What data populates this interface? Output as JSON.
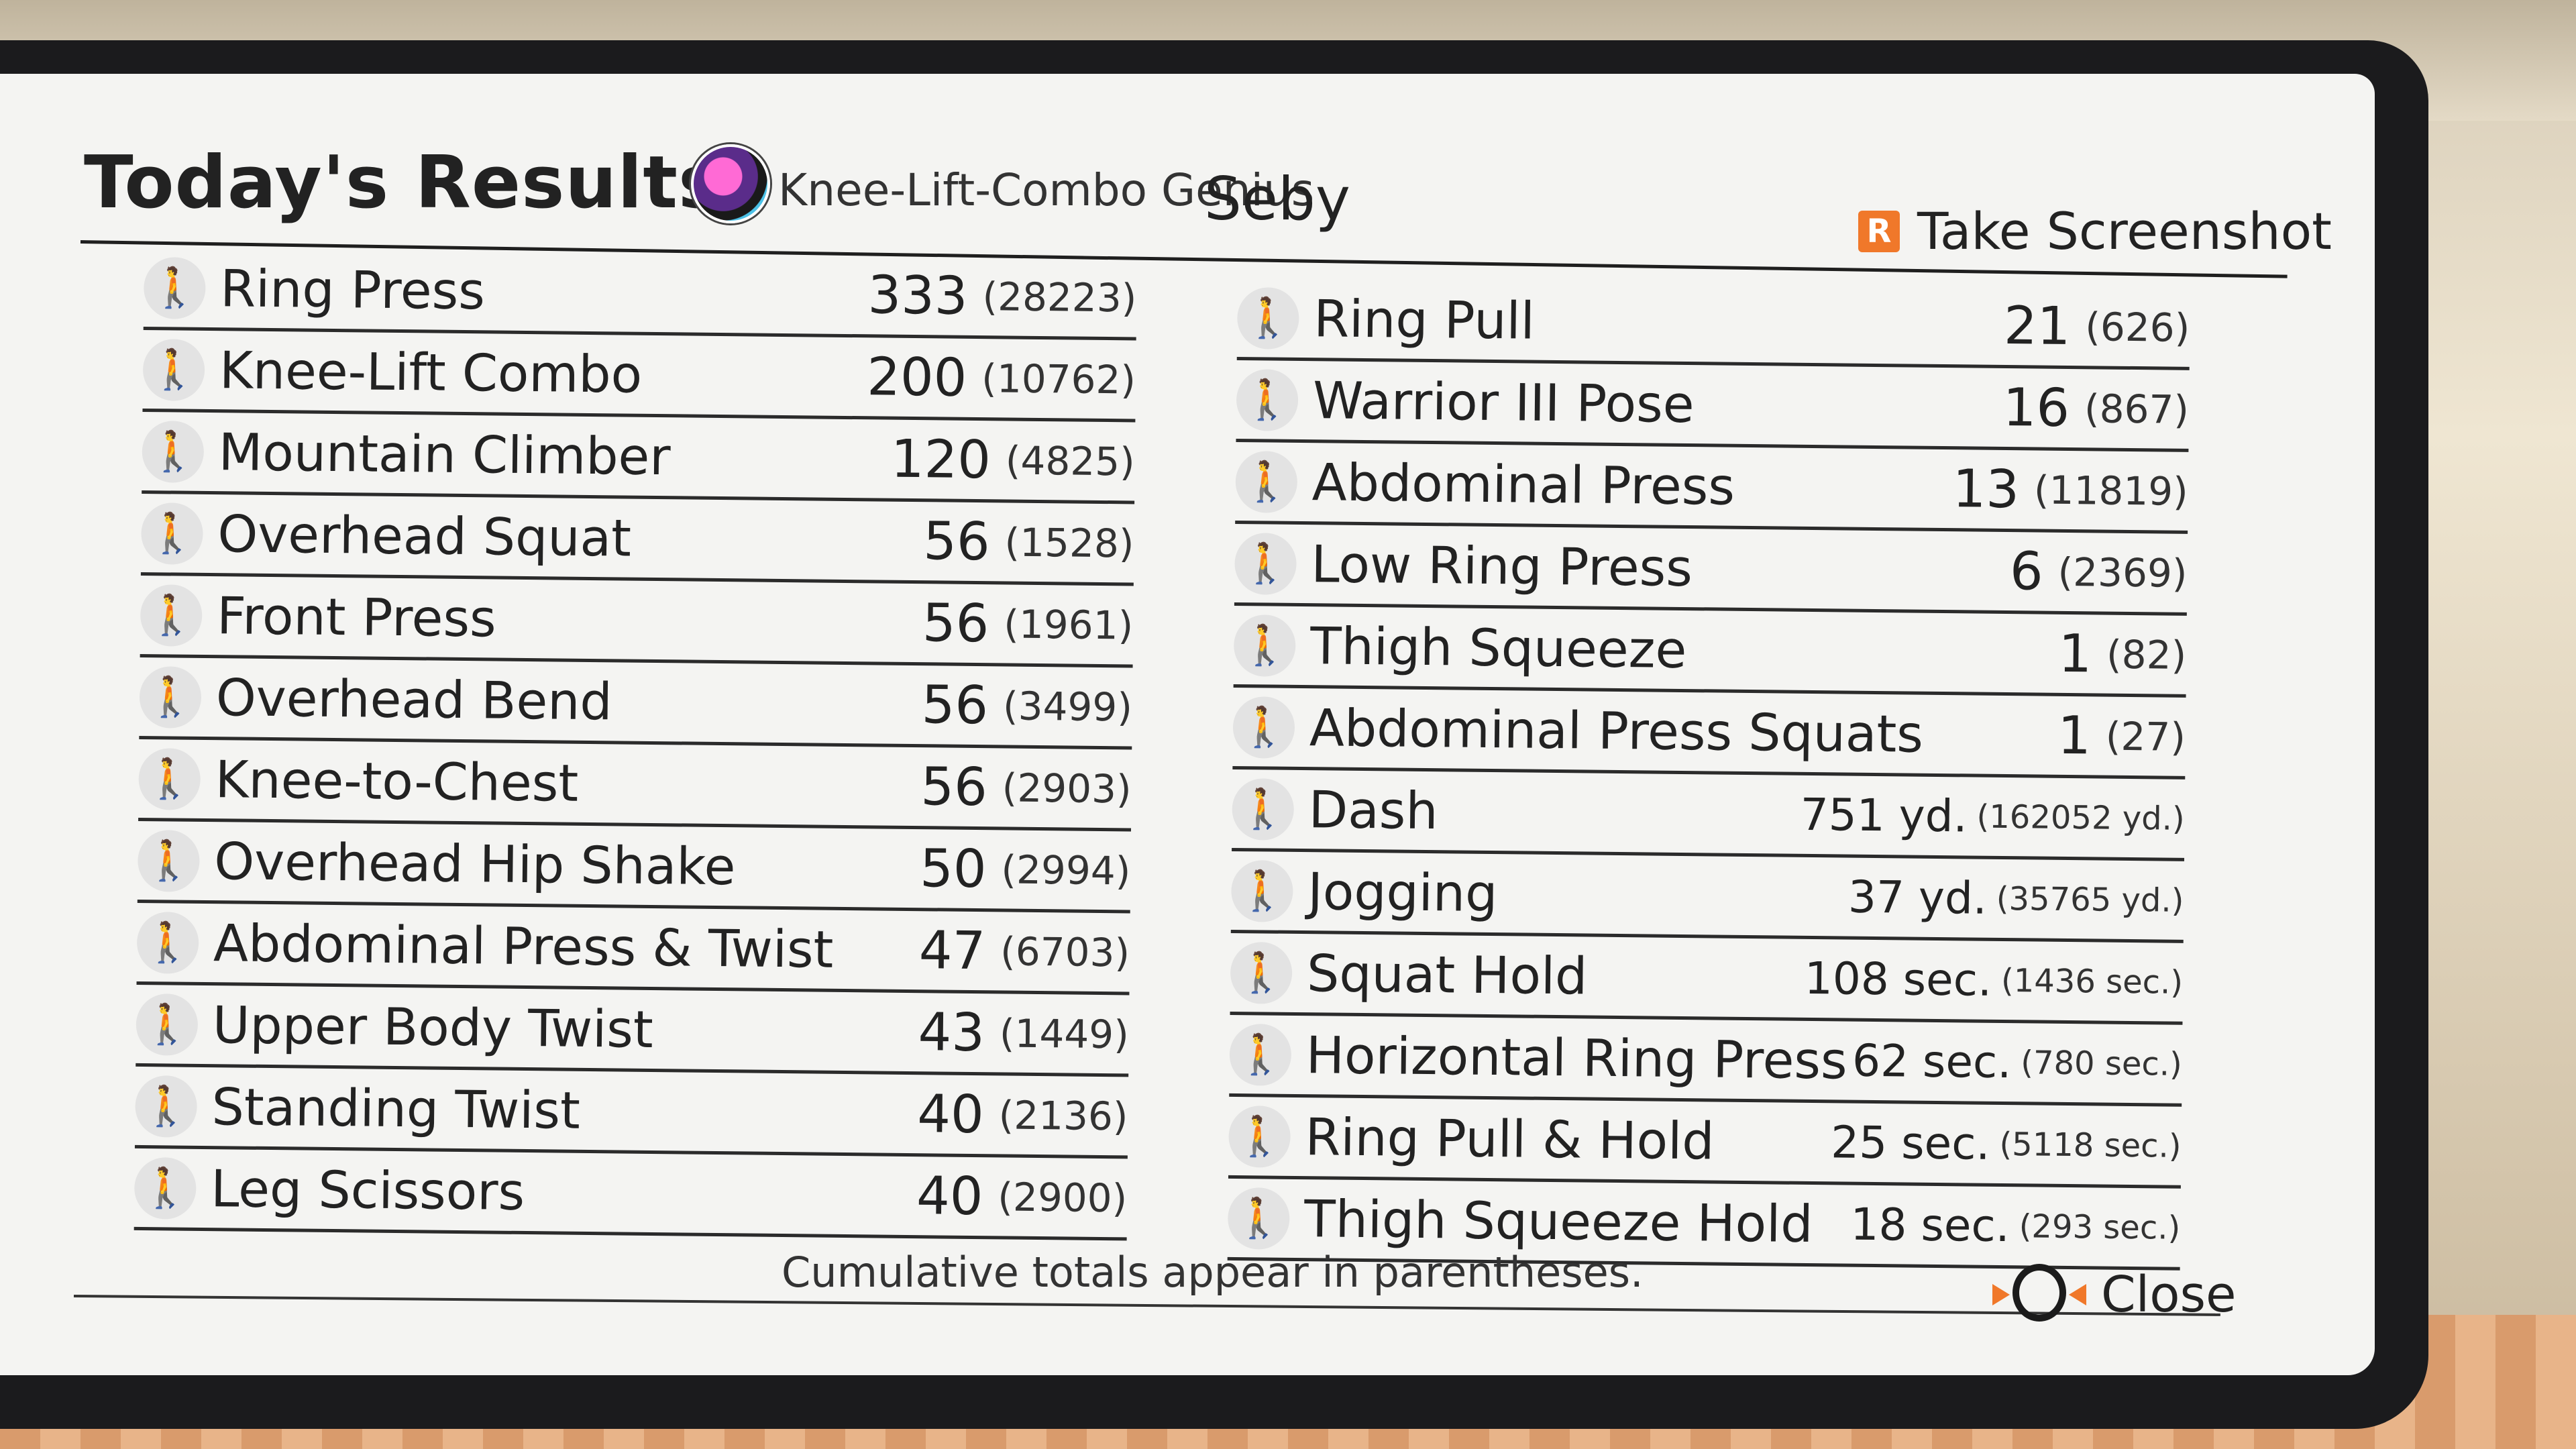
{
  "header": {
    "title": "Today's Results",
    "user_title": "Knee-Lift-Combo Genius",
    "user_name": "Seby",
    "screenshot_button": "R",
    "screenshot_label": "Take Screenshot"
  },
  "left_column": [
    {
      "name": "Ring Press",
      "value": "333",
      "cumulative": "(28223)"
    },
    {
      "name": "Knee-Lift Combo",
      "value": "200",
      "cumulative": "(10762)"
    },
    {
      "name": "Mountain Climber",
      "value": "120",
      "cumulative": "(4825)"
    },
    {
      "name": "Overhead Squat",
      "value": "56",
      "cumulative": "(1528)"
    },
    {
      "name": "Front Press",
      "value": "56",
      "cumulative": "(1961)"
    },
    {
      "name": "Overhead Bend",
      "value": "56",
      "cumulative": "(3499)"
    },
    {
      "name": "Knee-to-Chest",
      "value": "56",
      "cumulative": "(2903)"
    },
    {
      "name": "Overhead Hip Shake",
      "value": "50",
      "cumulative": "(2994)"
    },
    {
      "name": "Abdominal Press & Twist",
      "value": "47",
      "cumulative": "(6703)"
    },
    {
      "name": "Upper Body Twist",
      "value": "43",
      "cumulative": "(1449)"
    },
    {
      "name": "Standing Twist",
      "value": "40",
      "cumulative": "(2136)"
    },
    {
      "name": "Leg Scissors",
      "value": "40",
      "cumulative": "(2900)"
    }
  ],
  "right_column": [
    {
      "name": "Ring Pull",
      "value": "21",
      "cumulative": "(626)"
    },
    {
      "name": "Warrior III Pose",
      "value": "16",
      "cumulative": "(867)"
    },
    {
      "name": "Abdominal Press",
      "value": "13",
      "cumulative": "(11819)"
    },
    {
      "name": "Low Ring Press",
      "value": "6",
      "cumulative": "(2369)"
    },
    {
      "name": "Thigh Squeeze",
      "value": "1",
      "cumulative": "(82)"
    },
    {
      "name": "Abdominal Press Squats",
      "value": "1",
      "cumulative": "(27)"
    },
    {
      "name": "Dash",
      "value": "751 yd.",
      "cumulative": "(162052 yd.)"
    },
    {
      "name": "Jogging",
      "value": "37 yd.",
      "cumulative": "(35765 yd.)"
    },
    {
      "name": "Squat Hold",
      "value": "108 sec.",
      "cumulative": "(1436 sec.)"
    },
    {
      "name": "Horizontal Ring Press",
      "value": "62 sec.",
      "cumulative": "(780 sec.)"
    },
    {
      "name": "Ring Pull & Hold",
      "value": "25 sec.",
      "cumulative": "(5118 sec.)"
    },
    {
      "name": "Thigh Squeeze Hold",
      "value": "18 sec.",
      "cumulative": "(293 sec.)"
    }
  ],
  "footer": {
    "note": "Cumulative totals appear in parentheses.",
    "close_label": "Close"
  },
  "colors": {
    "accent": "#f0782a",
    "panel": "#f4f4f2",
    "bezel": "#1b1b1d"
  },
  "icons": {
    "exercise_icon": "person-figure-icon",
    "avatar": "avatar",
    "close": "ring-con-icon"
  }
}
